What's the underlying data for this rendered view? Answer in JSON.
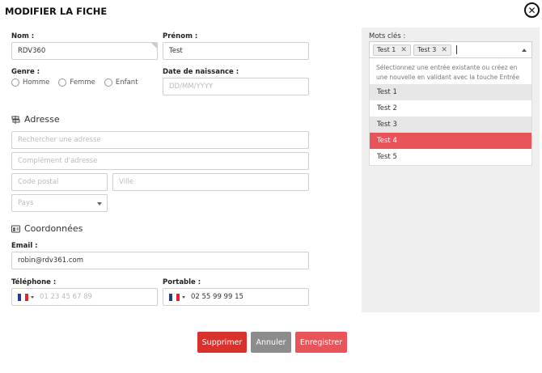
{
  "header": {
    "title": "MODIFIER LA FICHE",
    "close_icon": "close-circle-icon"
  },
  "form": {
    "nom": {
      "label": "Nom :",
      "value": "RDV360"
    },
    "prenom": {
      "label": "Prénom :",
      "value": "Test"
    },
    "genre": {
      "label": "Genre :",
      "options": [
        "Homme",
        "Femme",
        "Enfant"
      ]
    },
    "naissance": {
      "label": "Date de naissance :",
      "placeholder": "DD/MM/YYYY"
    },
    "adresse": {
      "heading": "Adresse",
      "icon": "signpost-icon",
      "search_placeholder": "Rechercher une adresse",
      "complement_placeholder": "Complément d'adresse",
      "postal_placeholder": "Code postal",
      "ville_placeholder": "Ville",
      "pays_placeholder": "Pays"
    },
    "coordonnees": {
      "heading": "Coordonnées",
      "icon": "id-card-icon",
      "email_label": "Email :",
      "email_value": "robin@rdv361.com",
      "telephone_label": "Téléphone :",
      "telephone_placeholder": "01 23 45 67 89",
      "portable_label": "Portable :",
      "portable_value": "02 55 99 99 15"
    }
  },
  "keywords": {
    "label": "Mots clés :",
    "selected_tags": [
      "Test 1",
      "Test 3"
    ],
    "hint": "Sélectionnez une entrée existante ou créez en une nouvelle en validant avec la touche Entrée",
    "options": [
      "Test 1",
      "Test 2",
      "Test 3",
      "Test 4",
      "Test 5"
    ],
    "highlighted": "Test 4"
  },
  "colors": {
    "danger": "#d9312b",
    "neutral": "#8c8c8c",
    "accent": "#e9545b",
    "flag": [
      "#1f3e9b",
      "#ffffff",
      "#e1262b"
    ]
  },
  "actions": {
    "delete_label": "Supprimer",
    "cancel_label": "Annuler",
    "save_label": "Enregistrer"
  }
}
